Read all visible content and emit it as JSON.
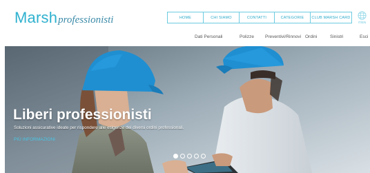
{
  "brand": {
    "name": "Marsh",
    "tagline": "professionisti"
  },
  "topnav": [
    {
      "label": "HOME"
    },
    {
      "label": "CHI SIAMO"
    },
    {
      "label": "CONTATTI"
    },
    {
      "label": "CATEGORIE"
    },
    {
      "label": "CLUB MARSH CARD"
    }
  ],
  "language": {
    "icon": "globe-icon",
    "label": "IT/EN"
  },
  "subnav": [
    {
      "label": "Dati Personali"
    },
    {
      "label": "Polizze"
    },
    {
      "label": "Preventivi/Rinnovi"
    },
    {
      "label": "Ordini"
    },
    {
      "label": "Sinistri"
    },
    {
      "label": "Esci"
    }
  ],
  "hero": {
    "title": "Liberi professionisti",
    "description": "Soluzioni assicurative ideate per rispondere alle esigenze dei diversi ordini professionali.",
    "link": "PIÙ INFORMAZIONI"
  },
  "carousel": {
    "slide_count": 5,
    "active_index": 0
  },
  "colors": {
    "accent": "#2fb1cf",
    "helmet": "#1f8fd1",
    "link": "#48c6e6"
  }
}
